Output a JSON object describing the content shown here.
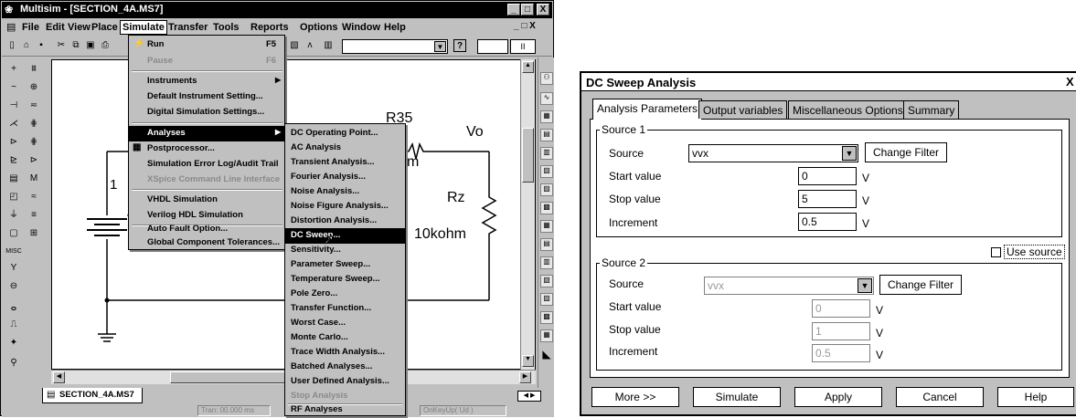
{
  "window": {
    "title": "Multisim - [SECTION_4A.MS7]",
    "min": "_",
    "max": "□",
    "close": "X",
    "doc_controls": "_ □ X"
  },
  "menubar": [
    "File",
    "Edit",
    "View",
    "Place",
    "Simulate",
    "Transfer",
    "Tools",
    "Reports",
    "Options",
    "Window",
    "Help"
  ],
  "simulate_menu": [
    {
      "label": "Run",
      "shortcut": "F5",
      "enabled": true
    },
    {
      "label": "Pause",
      "shortcut": "F6",
      "enabled": false
    },
    {
      "label": "Instruments",
      "submenu": true,
      "enabled": true
    },
    {
      "label": "Default Instrument Setting...",
      "enabled": true
    },
    {
      "label": "Digital Simulation Settings...",
      "enabled": true
    },
    {
      "label": "Analyses",
      "submenu": true,
      "enabled": true,
      "highlighted": true
    },
    {
      "label": "Postprocessor...",
      "enabled": true
    },
    {
      "label": "Simulation Error Log/Audit Trail",
      "enabled": true
    },
    {
      "label": "XSpice Command Line Interface",
      "enabled": false
    },
    {
      "label": "VHDL Simulation",
      "enabled": true
    },
    {
      "label": "Verilog HDL Simulation",
      "enabled": true
    },
    {
      "label": "Auto Fault Option...",
      "enabled": true
    },
    {
      "label": "Global Component Tolerances...",
      "enabled": true
    }
  ],
  "analyses_menu": [
    {
      "label": "DC Operating Point...",
      "enabled": true
    },
    {
      "label": "AC Analysis",
      "enabled": true
    },
    {
      "label": "Transient Analysis...",
      "enabled": true
    },
    {
      "label": "Fourier Analysis...",
      "enabled": true
    },
    {
      "label": "Noise Analysis...",
      "enabled": true
    },
    {
      "label": "Noise Figure Analysis...",
      "enabled": true
    },
    {
      "label": "Distortion Analysis...",
      "enabled": true
    },
    {
      "label": "DC Sweep...",
      "enabled": true,
      "selected": true
    },
    {
      "label": "Sensitivity...",
      "enabled": true
    },
    {
      "label": "Parameter Sweep...",
      "enabled": true
    },
    {
      "label": "Temperature Sweep...",
      "enabled": true
    },
    {
      "label": "Pole Zero...",
      "enabled": true
    },
    {
      "label": "Transfer Function...",
      "enabled": true
    },
    {
      "label": "Worst Case...",
      "enabled": true
    },
    {
      "label": "Monte Carlo...",
      "enabled": true
    },
    {
      "label": "Trace Width Analysis...",
      "enabled": true
    },
    {
      "label": "Batched Analyses...",
      "enabled": true
    },
    {
      "label": "User Defined Analysis...",
      "enabled": true
    },
    {
      "label": "Stop Analysis",
      "enabled": false
    },
    {
      "label": "RF Analyses",
      "enabled": true
    }
  ],
  "schematic": {
    "labels": {
      "r35": "R35",
      "vo": "Vo",
      "m": "m",
      "rz": "Rz",
      "rz_value": "10kohm",
      "one": "1",
      "v": "V"
    }
  },
  "tab_strip": {
    "doc_tab": "SECTION_4A.MS7"
  },
  "status_bar": {
    "cell1": "Tran: 00.000 ms",
    "cell2": "OnKeyUp( Ud )"
  },
  "dialog": {
    "title": "DC Sweep Analysis",
    "close": "X",
    "tabs": [
      "Analysis Parameters",
      "Output variables",
      "Miscellaneous Options",
      "Summary"
    ],
    "active_tab": "Analysis Parameters",
    "source1": {
      "group_label": "Source 1",
      "source_label": "Source",
      "source_value": "vvx",
      "change_filter": "Change Filter",
      "start_label": "Start value",
      "start_value": "0",
      "start_unit": "V",
      "stop_label": "Stop value",
      "stop_value": "5",
      "stop_unit": "V",
      "inc_label": "Increment",
      "inc_value": "0.5",
      "inc_unit": "V"
    },
    "use_source": "Use source",
    "source2": {
      "group_label": "Source 2",
      "source_label": "Source",
      "source_value": "vvx",
      "change_filter": "Change Filter",
      "start_label": "Start value",
      "start_value": "0",
      "start_unit": "V",
      "stop_label": "Stop value",
      "stop_value": "1",
      "stop_unit": "V",
      "inc_label": "Increment",
      "inc_value": "0.5",
      "inc_unit": "V"
    },
    "buttons": [
      "More >>",
      "Simulate",
      "Apply",
      "Cancel",
      "Help"
    ]
  }
}
